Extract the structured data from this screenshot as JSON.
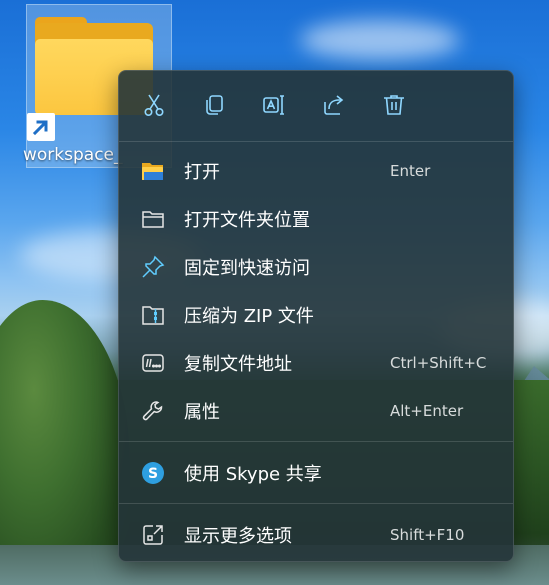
{
  "desktop": {
    "icon_label": "workspace_"
  },
  "context_menu": {
    "toolbar": [
      {
        "name": "cut-icon"
      },
      {
        "name": "copy-icon"
      },
      {
        "name": "rename-icon"
      },
      {
        "name": "share-icon"
      },
      {
        "name": "delete-icon"
      }
    ],
    "items": [
      {
        "label": "打开",
        "accelerator": "Enter",
        "icon": "folder-open-color-icon"
      },
      {
        "label": "打开文件夹位置",
        "accelerator": "",
        "icon": "folder-outline-icon"
      },
      {
        "label": "固定到快速访问",
        "accelerator": "",
        "icon": "pin-icon"
      },
      {
        "label": "压缩为 ZIP 文件",
        "accelerator": "",
        "icon": "zip-folder-icon"
      },
      {
        "label": "复制文件地址",
        "accelerator": "Ctrl+Shift+C",
        "icon": "copy-path-icon"
      },
      {
        "label": "属性",
        "accelerator": "Alt+Enter",
        "icon": "wrench-icon"
      },
      {
        "label": "使用 Skype 共享",
        "accelerator": "",
        "icon": "skype-icon"
      },
      {
        "label": "显示更多选项",
        "accelerator": "Shift+F10",
        "icon": "show-more-icon"
      }
    ]
  },
  "colors": {
    "accent": "#60cdff",
    "menu_background": "#243438",
    "folder_yellow": "#fcc63f",
    "skype_blue": "#2e9fe0"
  }
}
